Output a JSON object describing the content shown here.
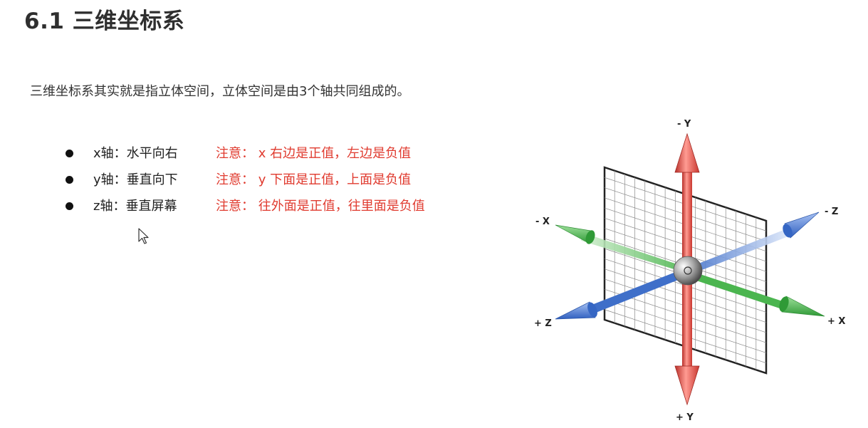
{
  "title": "6.1 三维坐标系",
  "intro": "三维坐标系其实就是指立体空间，立体空间是由3个轴共同组成的。",
  "bullets": [
    {
      "axis": "x轴：水平向右",
      "note": "注意： x 右边是正值，左边是负值"
    },
    {
      "axis": "y轴：垂直向下",
      "note": "注意： y 下面是正值，上面是负值"
    },
    {
      "axis": "z轴：垂直屏幕",
      "note": "注意： 往外面是正值，往里面是负值"
    }
  ],
  "diagram": {
    "labels": {
      "neg_y": "- Y",
      "pos_y": "+ Y",
      "neg_x": "- X",
      "pos_x": "+ X",
      "neg_z": "- Z",
      "pos_z": "+ Z"
    },
    "colors": {
      "y_axis": "#e8574f",
      "x_axis": "#46b34a",
      "z_axis": "#3f6fc9",
      "grid": "#8a8a8a"
    }
  },
  "colors": {
    "note": "#e03b2f",
    "title": "#2f2f2f"
  },
  "icons": {
    "bullet": "bullet-dot-icon",
    "cursor": "mouse-pointer-icon"
  }
}
